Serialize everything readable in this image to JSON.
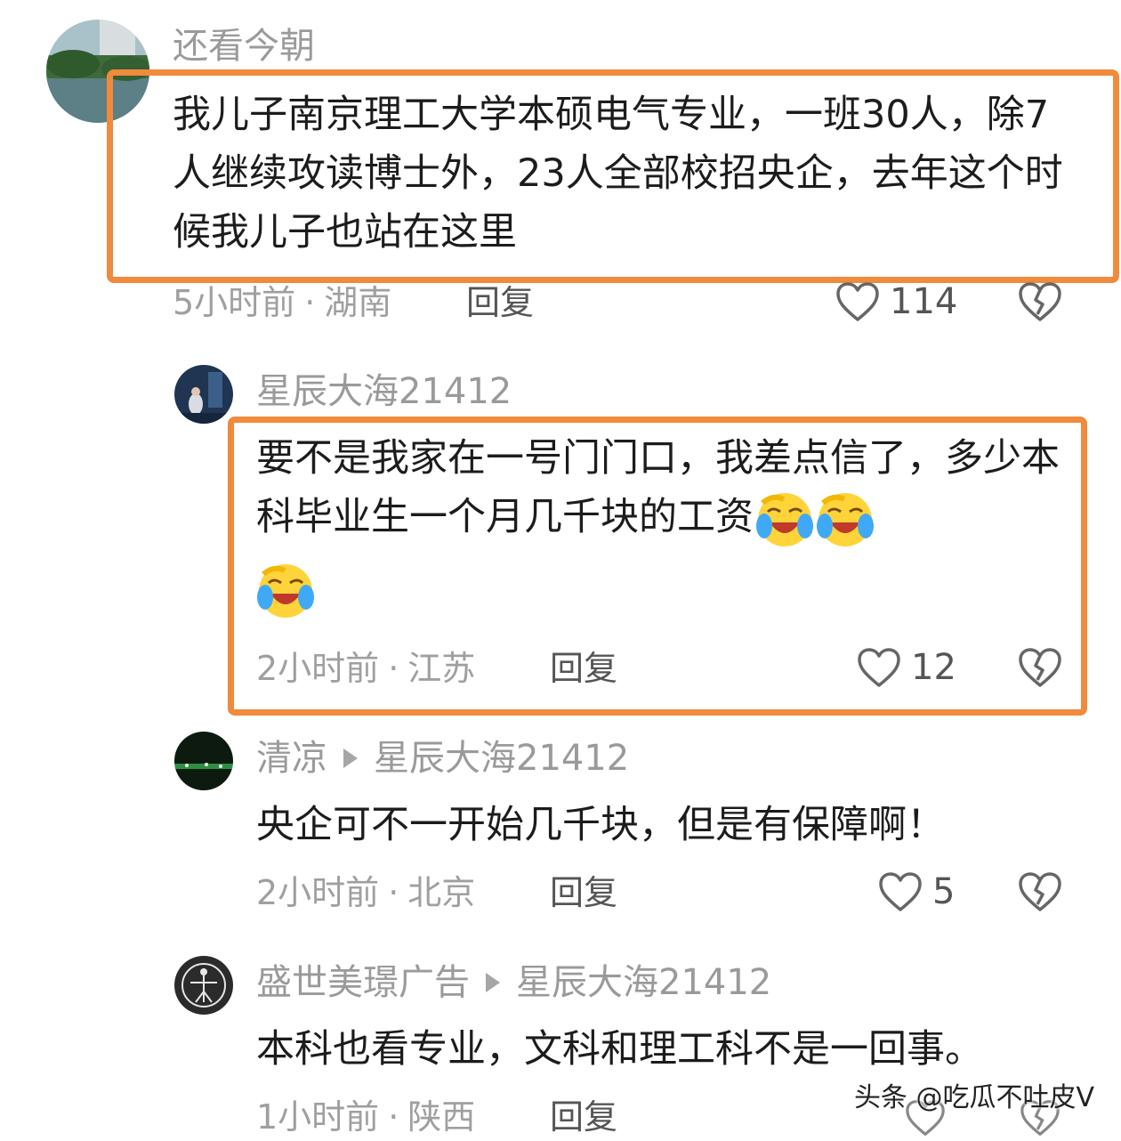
{
  "comments": [
    {
      "author": "还看今朝",
      "text": "我儿子南京理工大学本硕电气专业，一班30人，除7人继续攻读博士外，23人全部校招央企，去年这个时候我儿子也站在这里",
      "time": "5小时前",
      "location": "湖南",
      "reply_label": "回复",
      "likes": "114",
      "highlighted": true
    },
    {
      "author": "星辰大海21412",
      "text": "要不是我家在一号门门口，我差点信了，多少本科毕业生一个月几千块的工资",
      "emojis": [
        "crying-laugh-emoji",
        "crying-laugh-emoji",
        "crying-laugh-emoji"
      ],
      "time": "2小时前",
      "location": "江苏",
      "reply_label": "回复",
      "likes": "12",
      "highlighted": true
    },
    {
      "author": "清凉",
      "reply_to": "星辰大海21412",
      "text": "央企可不一开始几千块，但是有保障啊！",
      "time": "2小时前",
      "location": "北京",
      "reply_label": "回复",
      "likes": "5"
    },
    {
      "author": "盛世美璟广告",
      "reply_to": "星辰大海21412",
      "text": "本科也看专业，文科和理工科不是一回事。",
      "time": "1小时前",
      "location": "陕西",
      "reply_label": "回复"
    }
  ],
  "watermark": "头条 @吃瓜不吐皮V",
  "colors": {
    "highlight_border": "#f08a3c",
    "meta_text": "#9f9f9f",
    "name_text": "#9a9a9a"
  }
}
